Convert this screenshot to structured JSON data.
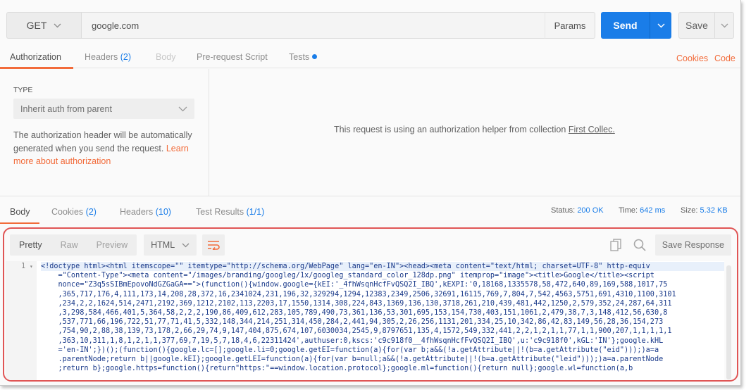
{
  "request": {
    "method": "GET",
    "url": "google.com",
    "params_label": "Params",
    "send_label": "Send",
    "save_label": "Save"
  },
  "request_tabs": [
    {
      "label": "Authorization",
      "count": ""
    },
    {
      "label": "Headers",
      "count": "(2)"
    },
    {
      "label": "Body",
      "count": ""
    },
    {
      "label": "Pre-request Script",
      "count": ""
    },
    {
      "label": "Tests",
      "count": ""
    }
  ],
  "links": {
    "cookies": "Cookies",
    "code": "Code"
  },
  "auth": {
    "type_label": "TYPE",
    "selected_type": "Inherit auth from parent",
    "description": "The authorization header will be automatically generated when you send the request.",
    "learn_more": "Learn more about authorization",
    "message": "This request is using an authorization helper from collection",
    "collection_link": "First Collec."
  },
  "response_tabs": [
    {
      "label": "Body",
      "count": ""
    },
    {
      "label": "Cookies",
      "count": "(2)"
    },
    {
      "label": "Headers",
      "count": "(10)"
    },
    {
      "label": "Test Results",
      "count": "(1/1)"
    }
  ],
  "response_meta": {
    "status_label": "Status:",
    "status_value": "200 OK",
    "time_label": "Time:",
    "time_value": "642 ms",
    "size_label": "Size:",
    "size_value": "5.32 KB"
  },
  "view_modes": [
    "Pretty",
    "Raw",
    "Preview"
  ],
  "format": "HTML",
  "save_response_label": "Save Response",
  "code": {
    "line_number": "1",
    "lines": [
      "<!doctype html><html itemscope=\"\" itemtype=\"http://schema.org/WebPage\" lang=\"en-IN\"><head><meta content=\"text/html; charset=UTF-8\" http-equiv",
      "    =\"Content-Type\"><meta content=\"/images/branding/googleg/1x/googleg_standard_color_128dp.png\" itemprop=\"image\"><title>Google</title><script",
      "    nonce=\"Z3q5sSIBmEpovoNdGZGaGA==\">(function(){window.google={kEI:'_4fhWsqnHcfFvQSQ2I_IBQ',kEXPI:'0,18168,1335578,58,472,640,89,169,588,1017,75",
      "    ,365,717,176,4,111,173,14,208,28,372,16,2341024,231,196,32,329294,1294,12383,2349,2506,32691,16115,769,7,804,7,542,4563,5751,691,4310,1100,3101",
      "    ,234,2,2,1624,514,2471,2192,369,1212,2102,113,2203,17,1550,1314,308,224,843,1369,136,130,3718,261,210,439,481,442,1250,2,579,352,24,287,64,311",
      "    ,3,298,584,466,401,5,364,58,2,2,2,190,86,409,612,283,105,789,490,73,361,136,53,301,695,153,154,730,403,151,1061,2,479,38,7,3,148,412,56,630,8",
      "    ,537,771,66,196,722,51,77,71,41,5,332,148,344,214,251,314,450,284,2,441,94,305,2,26,256,1131,201,334,25,10,342,86,42,83,149,56,28,36,154,273",
      "    ,754,90,2,88,38,139,73,178,2,66,29,74,9,147,404,875,674,107,6030034,2545,9,8797651,135,4,1572,549,332,441,2,2,1,2,1,1,77,1,1,900,207,1,1,1,1,1",
      "    ,363,10,311,1,8,1,2,1,1,377,69,7,19,5,7,18,4,6,22311424',authuser:0,kscs:'c9c918f0__4fhWsqnHcfFvQSQ2I_IBQ',u:'c9c918f0',kGL:'IN'};google.kHL",
      "    ='en-IN';})();(function(){google.lc=[];google.li=0;google.getEI=function(a){for(var b;a&&(!a.getAttribute||!(b=a.getAttribute(\"eid\")));)a=a",
      "    .parentNode;return b||google.kEI};google.getLEI=function(a){for(var b=null;a&&(!a.getAttribute||!(b=a.getAttribute(\"leid\")));)a=a.parentNode",
      "    ;return b};google.https=function(){return\"https:\"==window.location.protocol};google.ml=function(){return null};google.wl=function(a,b"
    ]
  },
  "colors": {
    "accent": "#f26b3a",
    "primary": "#1a7de8",
    "highlight_border": "#e05555"
  }
}
